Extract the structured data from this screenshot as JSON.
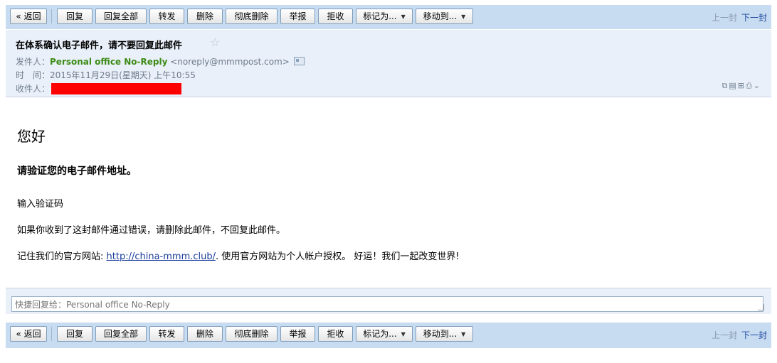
{
  "toolbar": {
    "back": "« 返回",
    "reply": "回复",
    "reply_all": "回复全部",
    "forward": "转发",
    "delete": "删除",
    "delete_permanently": "彻底删除",
    "report": "举报",
    "reject": "拒收",
    "mark_as": "标记为...",
    "move_to": "移动到...",
    "prev": "上一封",
    "next": "下一封"
  },
  "message": {
    "subject": "在体系确认电子邮件，请不要回复此邮件",
    "from_label": "发件人：",
    "sender_name": "Personal office No-Reply",
    "sender_email": "<noreply@mmmpost.com>",
    "time_label": "时　间：",
    "time_value": "2015年11月29日(星期天) 上午10:55",
    "to_label": "收件人："
  },
  "body": {
    "greeting": "您好",
    "heading": "请验证您的电子邮件地址。",
    "p1": "输入验证码",
    "p2": "如果你收到了这封邮件通过错误，请删除此邮件，不回复此邮件。",
    "p3_prefix": "记住我们的官方网站: ",
    "p3_link": "http://china-mmm.club/",
    "p3_suffix": ". 使用官方网站为个人帐户授权。 好运！我们一起改变世界!"
  },
  "quick_reply": {
    "placeholder": "快捷回复给：Personal office No-Reply"
  },
  "colors": {
    "toolbar_bg": "#c7dbf1",
    "header_bg": "#e9f0f9",
    "sender_green": "#3d8b16",
    "link_blue": "#1a3d9c",
    "redaction": "#ff0000"
  }
}
